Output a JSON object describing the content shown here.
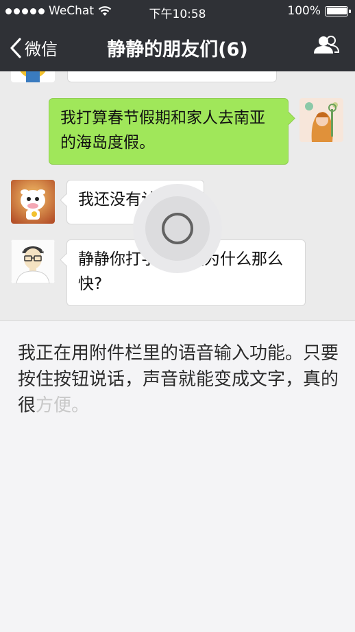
{
  "status_bar": {
    "carrier": "WeChat",
    "time": "下午10:58",
    "battery": "100%",
    "icons": [
      "signal-dots-icon",
      "wifi-icon",
      "battery-icon"
    ]
  },
  "nav": {
    "back_label": "微信",
    "title": "静静的朋友们(6)",
    "icons": [
      "back-chevron-icon",
      "group-members-icon"
    ]
  },
  "messages": [
    {
      "side": "left",
      "text": ""
    },
    {
      "side": "right",
      "text": "我打算春节假期和家人去南亚的海岛度假。"
    },
    {
      "side": "left",
      "text": "我还没有计划。"
    },
    {
      "side": "left",
      "text": "静静你打字的速度为什么那么快?"
    }
  ],
  "voice_input": {
    "recognized_text": "我正在用附件栏里的语音输入功能。只要按住按钮说话，声音就能变成文字，真的很",
    "pending_text": "方便。",
    "icons": [
      "microphone-button-icon"
    ]
  },
  "colors": {
    "header": "#2f3136",
    "chat_bg": "#ebebeb",
    "sent_bubble": "#a0e75a",
    "received_bubble": "#ffffff",
    "panel_bg": "#f4f4f6"
  }
}
